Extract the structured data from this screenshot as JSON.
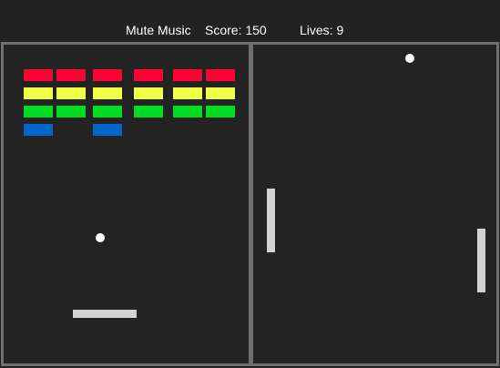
{
  "hud": {
    "mute_label": "Mute Music",
    "score_label": "Score:",
    "score_value": "150",
    "lives_label": "Lives:",
    "lives_value": "9"
  },
  "colors": {
    "background": "#222222",
    "panel_border": "#6f6f6f",
    "brick_red": "#ff0033",
    "brick_yellow": "#eeff44",
    "brick_green": "#00dd22",
    "brick_blue": "#0066cc",
    "paddle": "#d3d3d3",
    "ball": "#ffffff"
  },
  "breakout": {
    "brick_rows": [
      {
        "color": "red",
        "present": [
          true,
          true,
          true,
          true,
          true,
          true
        ]
      },
      {
        "color": "yellow",
        "present": [
          true,
          true,
          true,
          true,
          true,
          true
        ]
      },
      {
        "color": "green",
        "present": [
          true,
          true,
          true,
          true,
          true,
          true
        ]
      },
      {
        "color": "blue",
        "present": [
          true,
          false,
          true,
          false,
          false,
          false
        ]
      }
    ]
  },
  "pong": {
    "paddle_count": 2
  }
}
